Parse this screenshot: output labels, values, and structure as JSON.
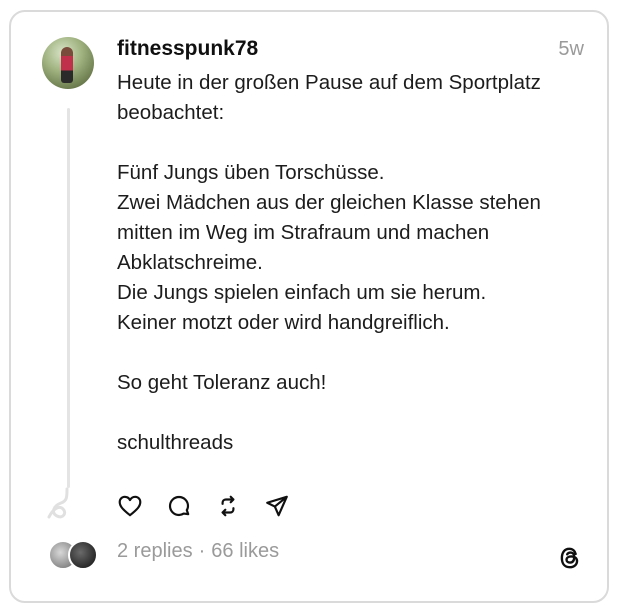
{
  "post": {
    "username": "fitnesspunk78",
    "time": "5w",
    "text": "Heute in der großen Pause auf dem Sportplatz\nbeobachtet:\n\nFünf Jungs üben Torschüsse.\nZwei Mädchen aus der gleichen Klasse stehen\nmitten im Weg im Strafraum und machen\nAbklatschreime.\nDie Jungs spielen einfach um sie herum.\nKeiner motzt oder wird handgreiflich.\n\nSo geht Toleranz auch!\n\nschulthreads"
  },
  "actions": [
    "heart-icon",
    "comment-icon",
    "repost-icon",
    "share-icon"
  ],
  "stats": {
    "replies": "2 replies",
    "separator": "·",
    "likes": "66 likes"
  },
  "colors": {
    "text": "#101010",
    "muted": "#9a9a9a",
    "border": "#dadada"
  }
}
